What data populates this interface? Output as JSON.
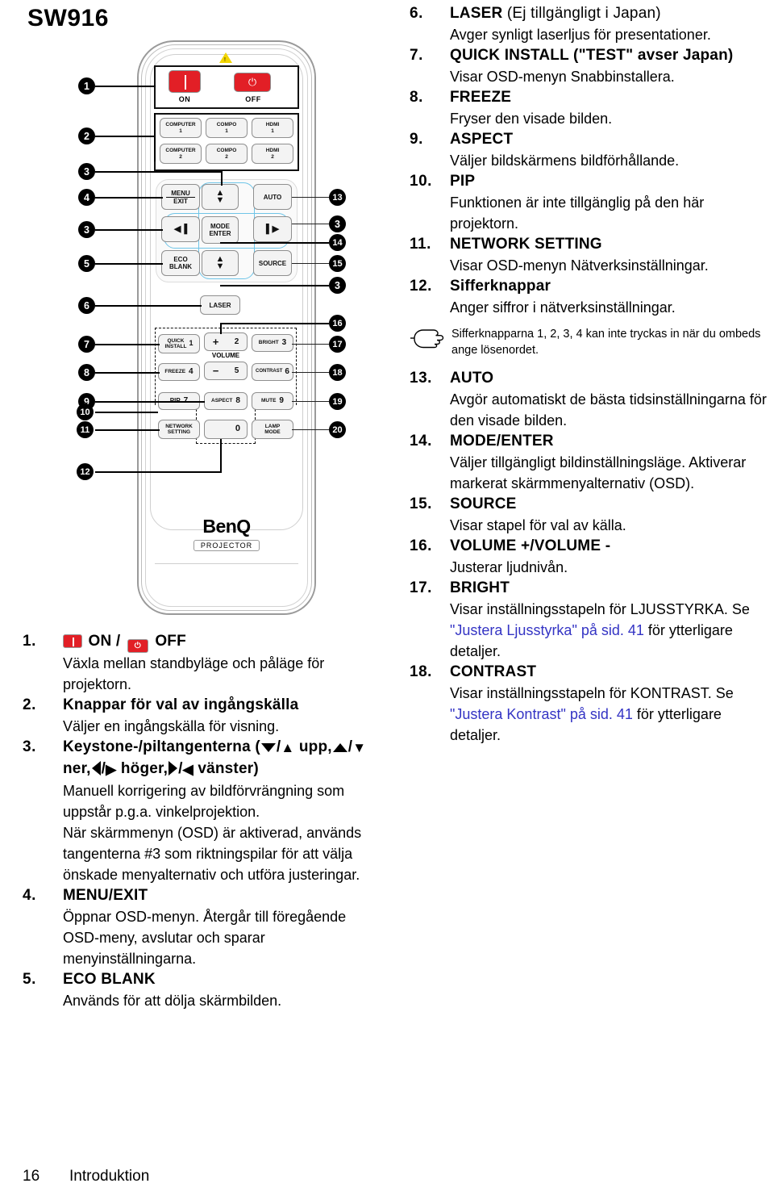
{
  "page": {
    "title": "SW916",
    "footer_page_number": "16",
    "footer_section": "Introduktion"
  },
  "colors": {
    "link": "#3434c4",
    "button_red": "#e21f26",
    "nav_ring_blue": "#6fc5e8",
    "warning_yellow": "#f2d500"
  },
  "remote": {
    "brand": "BenQ",
    "brand_sub": "PROJECTOR",
    "power": {
      "on_label": "ON",
      "off_label": "OFF",
      "off_glyph": "⏻"
    },
    "source_keys": [
      {
        "line1": "COMPUTER",
        "line2": "1"
      },
      {
        "line1": "COMPO",
        "line2": "1"
      },
      {
        "line1": "HDMI",
        "line2": "1"
      },
      {
        "line1": "COMPUTER",
        "line2": "2"
      },
      {
        "line1": "COMPO",
        "line2": "2"
      },
      {
        "line1": "HDMI",
        "line2": "2"
      }
    ],
    "nav_keys": {
      "menu": "MENU\nEXIT",
      "menu_l1": "MENU",
      "menu_l2": "EXIT",
      "auto": "AUTO",
      "mode_l1": "MODE",
      "mode_l2": "ENTER",
      "eco_l1": "ECO",
      "eco_l2": "BLANK",
      "source": "SOURCE",
      "laser": "LASER"
    },
    "keypad": [
      {
        "label": "QUICK\nINSTALL",
        "l1": "QUICK",
        "l2": "INSTALL",
        "digit": "1"
      },
      {
        "label": "VOLUME +",
        "l1": "+",
        "l2": "",
        "digit": "2"
      },
      {
        "label": "BRIGHT",
        "l1": "BRIGHT",
        "l2": "",
        "digit": "3"
      },
      {
        "label": "FREEZE",
        "l1": "FREEZE",
        "l2": "",
        "digit": "4"
      },
      {
        "label": "VOLUME -",
        "l1": "−",
        "l2": "",
        "digit": "5"
      },
      {
        "label": "CONTRAST",
        "l1": "CONTRAST",
        "l2": "",
        "digit": "6"
      },
      {
        "label": "PIP",
        "l1": "PIP",
        "l2": "",
        "digit": "7"
      },
      {
        "label": "ASPECT",
        "l1": "ASPECT",
        "l2": "",
        "digit": "8"
      },
      {
        "label": "MUTE",
        "l1": "MUTE",
        "l2": "",
        "digit": "9"
      },
      {
        "label": "NETWORK SETTING",
        "l1": "NETWORK",
        "l2": "SETTING",
        "digit": ""
      },
      {
        "label": "0",
        "l1": "",
        "l2": "",
        "digit": "0"
      },
      {
        "label": "LAMP MODE",
        "l1": "LAMP",
        "l2": "MODE",
        "digit": ""
      }
    ],
    "volume_label": "VOLUME",
    "callouts_left": [
      "1",
      "2",
      "3",
      "4",
      "3",
      "5",
      "6",
      "7",
      "8",
      "9",
      "10",
      "11",
      "12"
    ],
    "callouts_right": [
      "13",
      "3",
      "14",
      "15",
      "3",
      "16",
      "17",
      "18",
      "19",
      "20"
    ]
  },
  "left_items": [
    {
      "num": "1.",
      "title_has_icons": true,
      "title_on": "ON",
      "title_sep": "/",
      "title_off": "OFF",
      "desc": "Växla mellan standbyläge och påläge för projektorn."
    },
    {
      "num": "2.",
      "title": "Knappar för val av ingångskälla",
      "desc": "Väljer en ingångskälla för visning."
    },
    {
      "num": "3.",
      "title_keystone": true,
      "title_a": "Keystone-/piltangenterna (",
      "title_b": "upp,",
      "title_c": "ner,",
      "title_d": "höger,",
      "title_e": "vänster)",
      "desc1": "Manuell korrigering av bildförvrängning som uppstår p.g.a. vinkelprojektion.",
      "desc2": "När skärmmenyn (OSD) är aktiverad, används tangenterna #3 som riktningspilar för att välja önskade menyalternativ och utföra justeringar."
    },
    {
      "num": "4.",
      "title": "MENU/EXIT",
      "desc": "Öppnar OSD-menyn. Återgår till föregående OSD-meny, avslutar och sparar menyinställningarna."
    },
    {
      "num": "5.",
      "title": "ECO BLANK",
      "desc": "Används för att dölja skärmbilden."
    }
  ],
  "right_items": [
    {
      "num": "6.",
      "title": "LASER",
      "title_regular": " (Ej tillgängligt i Japan)",
      "desc": "Avger synligt laserljus för presentationer."
    },
    {
      "num": "7.",
      "title": "QUICK INSTALL (\"TEST\" avser Japan)",
      "desc": "Visar OSD-menyn Snabbinstallera."
    },
    {
      "num": "8.",
      "title": "FREEZE",
      "desc": "Fryser den visade bilden."
    },
    {
      "num": "9.",
      "title": "ASPECT",
      "desc": "Väljer bildskärmens bildförhållande."
    },
    {
      "num": "10.",
      "title": "PIP",
      "desc": "Funktionen är inte tillgänglig på den här projektorn."
    },
    {
      "num": "11.",
      "title": "NETWORK SETTING",
      "desc": "Visar OSD-menyn Nätverksinställningar."
    },
    {
      "num": "12.",
      "title": "Sifferknappar",
      "desc": "Anger siffror i nätverksinställningar."
    }
  ],
  "note": {
    "icon": "pointing-hand-icon",
    "text": "Sifferknapparna 1, 2, 3, 4 kan inte tryckas in när du ombeds ange lösenordet."
  },
  "right_items2": [
    {
      "num": "13.",
      "title": "AUTO",
      "desc": "Avgör automatiskt de bästa tidsinställningarna för den visade bilden."
    },
    {
      "num": "14.",
      "title": "MODE/ENTER",
      "desc": "Väljer tillgängligt bildinställningsläge. Aktiverar markerat skärmmenyalternativ (OSD)."
    },
    {
      "num": "15.",
      "title": "SOURCE",
      "desc": "Visar stapel för val av källa."
    },
    {
      "num": "16.",
      "title": "VOLUME +/VOLUME -",
      "desc": "Justerar ljudnivån."
    },
    {
      "num": "17.",
      "title": "BRIGHT",
      "desc_a": "Visar inställningsstapeln för LJUSSTYRKA. Se ",
      "desc_link": "\"Justera Ljusstyrka\" på sid. 41",
      "desc_b": " för ytterligare detaljer."
    },
    {
      "num": "18.",
      "title": "CONTRAST",
      "desc_a": "Visar inställningsstapeln för KONTRAST. Se ",
      "desc_link": "\"Justera Kontrast\" på sid. 41",
      "desc_b": " för ytterligare detaljer."
    }
  ]
}
